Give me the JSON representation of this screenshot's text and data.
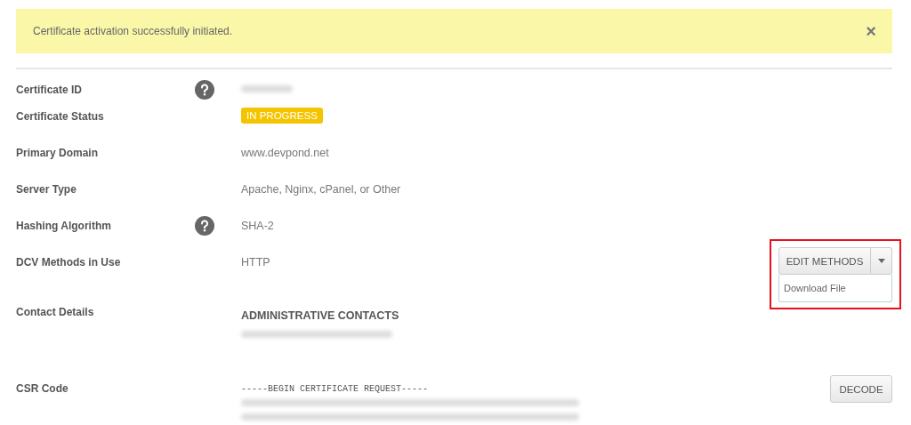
{
  "alert": {
    "message": "Certificate activation successfully initiated.",
    "close": "×"
  },
  "details": [
    {
      "label": "Certificate ID",
      "help": true,
      "kind": "redacted"
    },
    {
      "label": "Certificate Status",
      "help": false,
      "kind": "badge",
      "value": "IN PROGRESS"
    },
    {
      "label": "Primary Domain",
      "help": false,
      "kind": "text",
      "value": "www.devpond.net"
    },
    {
      "label": "Server Type",
      "help": false,
      "kind": "text",
      "value": "Apache, Nginx, cPanel, or Other"
    },
    {
      "label": "Hashing Algorithm",
      "help": true,
      "kind": "text",
      "value": "SHA-2"
    },
    {
      "label": "DCV Methods in Use",
      "help": false,
      "kind": "dcv",
      "value": "HTTP",
      "button": "EDIT METHODS",
      "menu_open": true,
      "highlighted": true,
      "menu": [
        "Download File"
      ]
    },
    {
      "label": "Contact Details",
      "help": false,
      "kind": "contacts",
      "value": "ADMINISTRATIVE CONTACTS"
    },
    {
      "label": "CSR Code",
      "help": false,
      "kind": "code",
      "value": "-----BEGIN CERTIFICATE REQUEST-----",
      "button": "DECODE"
    }
  ]
}
